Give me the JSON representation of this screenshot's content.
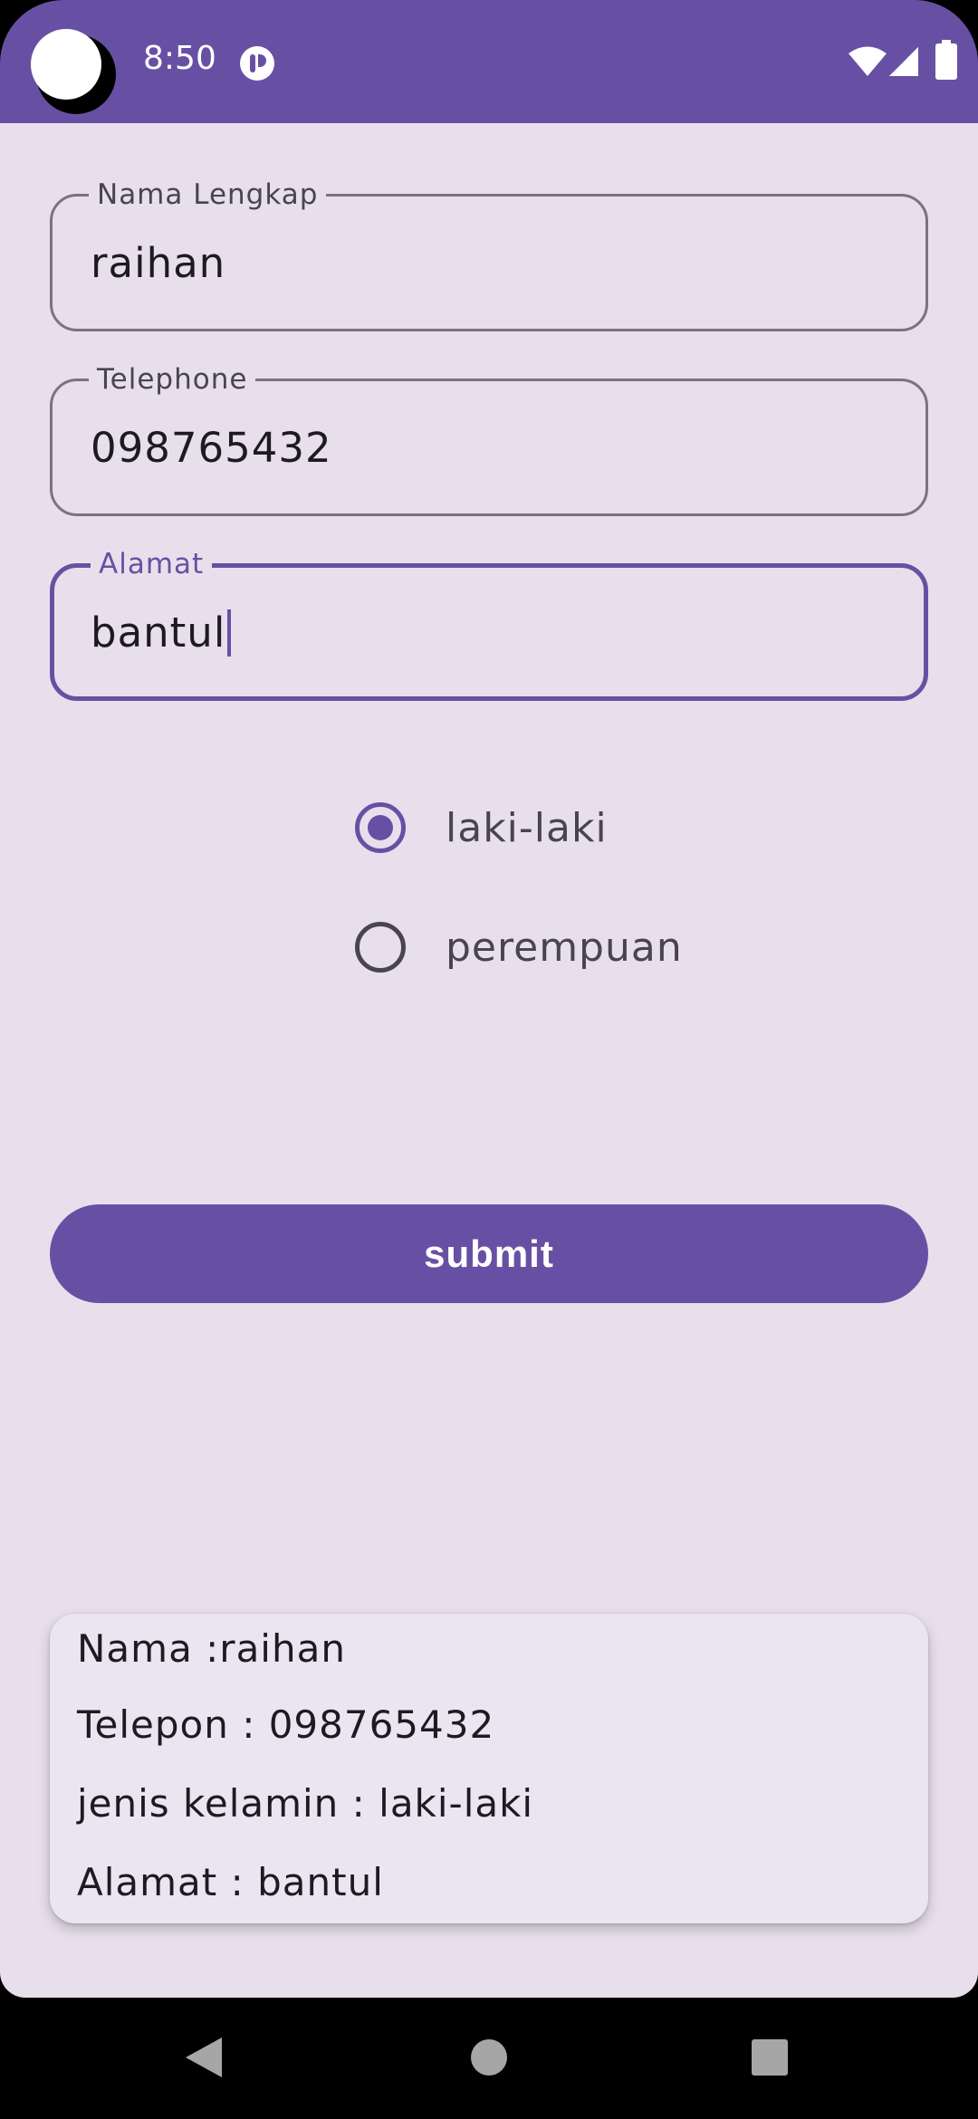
{
  "status_bar": {
    "time": "8:50",
    "icons": [
      "notification-app-icon",
      "wifi-icon",
      "signal-icon",
      "battery-icon"
    ]
  },
  "form": {
    "name_field": {
      "label": "Nama Lengkap",
      "value": "raihan"
    },
    "phone_field": {
      "label": "Telephone",
      "value": "098765432"
    },
    "address_field": {
      "label": "Alamat",
      "value": "bantul",
      "focused": true
    }
  },
  "gender": {
    "options": [
      {
        "label": "laki-laki",
        "checked": true
      },
      {
        "label": "perempuan",
        "checked": false
      }
    ]
  },
  "submit_label": "submit",
  "result": {
    "name_line": "Nama :raihan",
    "phone_line": "Telepon : 098765432",
    "gender_line": "jenis kelamin : laki-laki",
    "address_line": "Alamat : bantul"
  },
  "nav_bar": {
    "icons": [
      "back-icon",
      "home-icon",
      "recents-icon"
    ]
  },
  "colors": {
    "primary": "#6750a4",
    "background": "#e7e0ec",
    "outline": "#79747e",
    "text": "#1d1b20"
  }
}
